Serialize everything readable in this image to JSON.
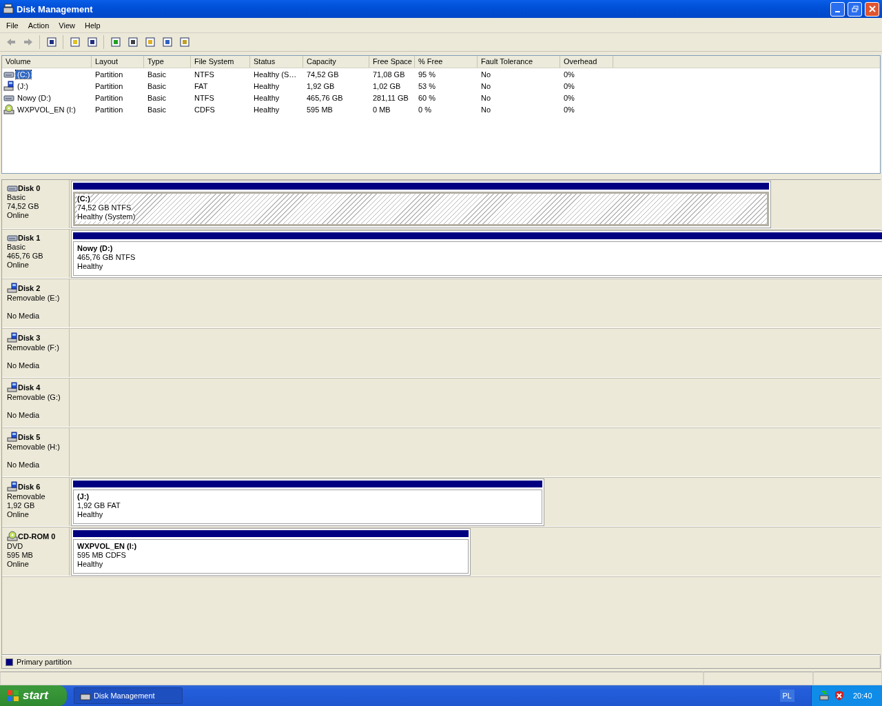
{
  "window": {
    "title": "Disk Management"
  },
  "menu": [
    "File",
    "Action",
    "View",
    "Help"
  ],
  "volume_list": {
    "columns": [
      "Volume",
      "Layout",
      "Type",
      "File System",
      "Status",
      "Capacity",
      "Free Space",
      "% Free",
      "Fault Tolerance",
      "Overhead"
    ],
    "rows": [
      {
        "kind": "hdd",
        "selected": true,
        "cells": [
          "(C:)",
          "Partition",
          "Basic",
          "NTFS",
          "Healthy (S…",
          "74,52 GB",
          "71,08 GB",
          "95 %",
          "No",
          "0%"
        ]
      },
      {
        "kind": "removable",
        "selected": false,
        "cells": [
          "(J:)",
          "Partition",
          "Basic",
          "FAT",
          "Healthy",
          "1,92 GB",
          "1,02 GB",
          "53 %",
          "No",
          "0%"
        ]
      },
      {
        "kind": "hdd",
        "selected": false,
        "cells": [
          "Nowy (D:)",
          "Partition",
          "Basic",
          "NTFS",
          "Healthy",
          "465,76 GB",
          "281,11 GB",
          "60 %",
          "No",
          "0%"
        ]
      },
      {
        "kind": "cdrom",
        "selected": false,
        "cells": [
          "WXPVOL_EN (I:)",
          "Partition",
          "Basic",
          "CDFS",
          "Healthy",
          "595 MB",
          "0 MB",
          "0 %",
          "No",
          "0%"
        ]
      }
    ]
  },
  "disks": [
    {
      "kind": "hdd",
      "name": "Disk 0",
      "lines": [
        "Basic",
        "74,52 GB",
        "Online"
      ],
      "partitions": [
        {
          "name": "(C:)",
          "size": "74,52 GB NTFS",
          "status": "Healthy (System)",
          "selected": true
        }
      ]
    },
    {
      "kind": "hdd",
      "name": "Disk 1",
      "lines": [
        "Basic",
        "465,76 GB",
        "Online"
      ],
      "partitions": [
        {
          "name": "Nowy  (D:)",
          "size": "465,76 GB NTFS",
          "status": "Healthy",
          "selected": false
        }
      ]
    },
    {
      "kind": "removable",
      "name": "Disk 2",
      "lines": [
        "Removable (E:)",
        "No Media"
      ]
    },
    {
      "kind": "removable",
      "name": "Disk 3",
      "lines": [
        "Removable (F:)",
        "No Media"
      ]
    },
    {
      "kind": "removable",
      "name": "Disk 4",
      "lines": [
        "Removable (G:)",
        "No Media"
      ]
    },
    {
      "kind": "removable",
      "name": "Disk 5",
      "lines": [
        "Removable (H:)",
        "No Media"
      ]
    },
    {
      "kind": "removable",
      "name": "Disk 6",
      "lines": [
        "Removable",
        "1,92 GB",
        "Online"
      ],
      "partitions": [
        {
          "name": "(J:)",
          "size": "1,92 GB FAT",
          "status": "Healthy",
          "selected": false
        }
      ]
    },
    {
      "kind": "cdrom",
      "name": "CD-ROM 0",
      "lines": [
        "DVD",
        "595 MB",
        "Online"
      ],
      "partitions": [
        {
          "name": "WXPVOL_EN  (I:)",
          "size": "595 MB CDFS",
          "status": "Healthy",
          "selected": false
        }
      ]
    }
  ],
  "legend": [
    {
      "label": "Primary partition",
      "color": "#000080"
    }
  ],
  "taskbar": {
    "start": "start",
    "task": "Disk Management",
    "language": "PL",
    "clock": "20:40"
  }
}
